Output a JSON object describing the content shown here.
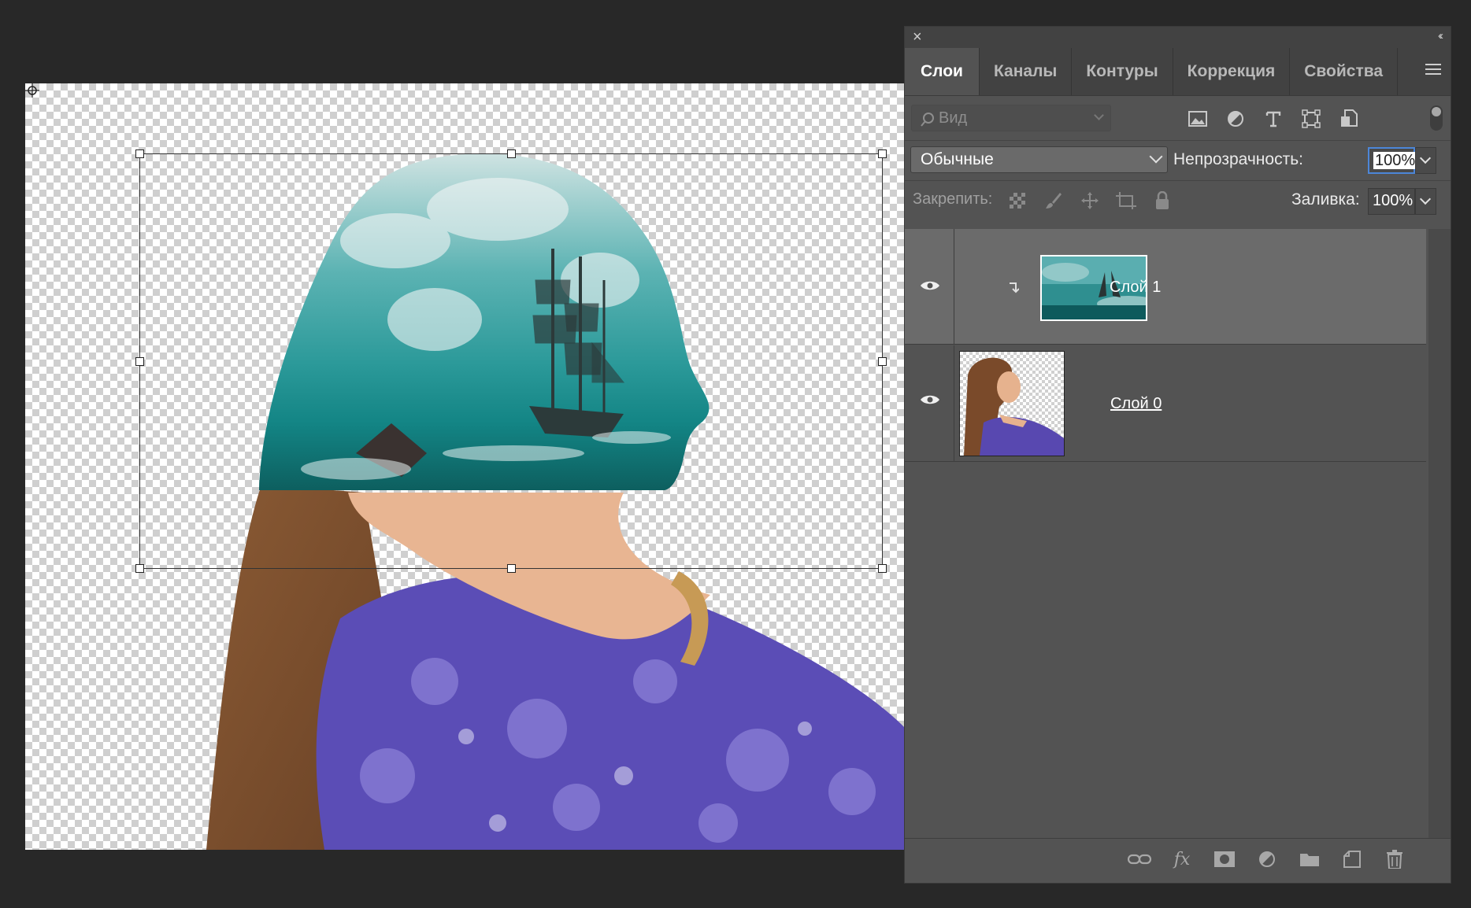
{
  "panel": {
    "tabs": [
      {
        "label": "Слои",
        "active": true
      },
      {
        "label": "Каналы",
        "active": false
      },
      {
        "label": "Контуры",
        "active": false
      },
      {
        "label": "Коррекция",
        "active": false
      },
      {
        "label": "Свойства",
        "active": false
      }
    ],
    "filter": {
      "label": "Вид",
      "kind_icons": [
        "image-filter-icon",
        "adjustment-filter-icon",
        "type-filter-icon",
        "shape-filter-icon",
        "smart-object-filter-icon"
      ]
    },
    "blend_mode": "Обычные",
    "opacity_label": "Непрозрачность:",
    "opacity_value": "100%",
    "lock_label": "Закрепить:",
    "fill_label": "Заливка:",
    "fill_value": "100%",
    "layers": [
      {
        "name": "Слой 1",
        "visible": true,
        "selected": true,
        "clipped": true
      },
      {
        "name": "Слой 0",
        "visible": true,
        "selected": false,
        "clipped": false
      }
    ],
    "bottom_icons": [
      "link-icon",
      "fx-icon",
      "mask-icon",
      "adjustment-layer-icon",
      "folder-icon",
      "new-layer-icon",
      "trash-icon"
    ]
  },
  "colors": {
    "panel_bg": "#535353",
    "selected_layer": "#6b6b6b",
    "accent": "#4c86d8"
  }
}
